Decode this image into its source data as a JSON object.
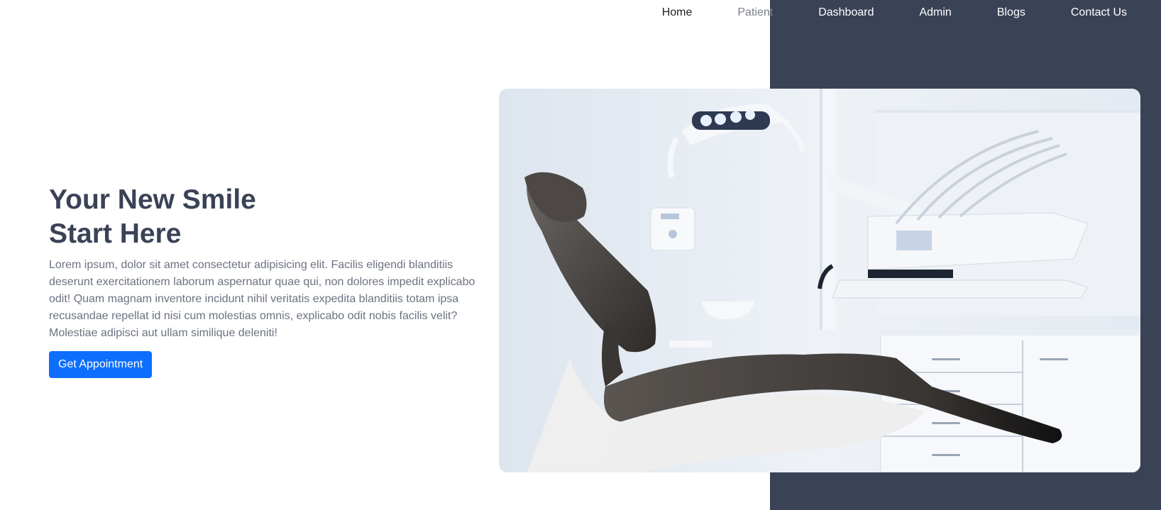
{
  "nav": {
    "items": [
      {
        "label": "Home"
      },
      {
        "label": "Patient"
      },
      {
        "label": "Dashboard"
      },
      {
        "label": "Admin"
      },
      {
        "label": "Blogs"
      },
      {
        "label": "Contact Us"
      }
    ]
  },
  "hero": {
    "title_line1": "Your New Smile",
    "title_line2": "Start Here",
    "description": "Lorem ipsum, dolor sit amet consectetur adipisicing elit. Facilis eligendi blanditiis deserunt exercitationem laborum aspernatur quae qui, non dolores impedit explicabo odit! Quam magnam inventore incidunt nihil veritatis expedita blanditiis totam ipsa recusandae repellat id nisi cum molestias omnis, explicabo odit nobis facilis velit? Molestiae adipisci aut ullam similique deleniti!",
    "button_label": "Get Appointment"
  },
  "colors": {
    "panel": "#3a4256",
    "heading": "#3a4256",
    "body_text": "#6b7280",
    "button": "#0d6efd"
  }
}
